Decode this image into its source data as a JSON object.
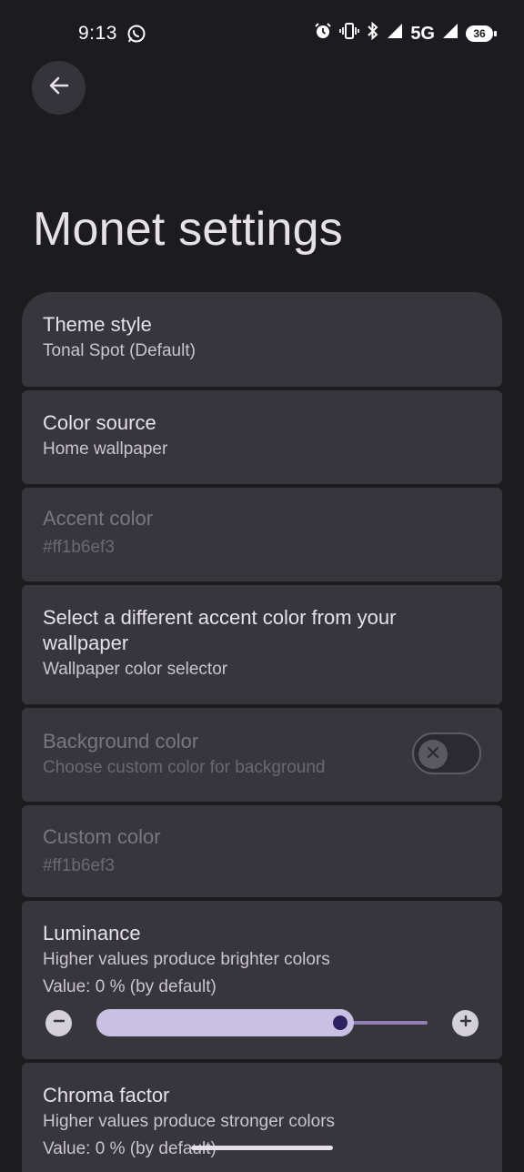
{
  "status_bar": {
    "time": "9:13",
    "network": "5G",
    "battery": "36",
    "icons": [
      "whatsapp-icon",
      "alarm-icon",
      "vibrate-icon",
      "bluetooth-icon",
      "signal-icon",
      "signal-5g-icon",
      "battery-icon"
    ]
  },
  "header": {
    "back_icon": "arrow-back-icon",
    "title": "Monet settings"
  },
  "settings": {
    "theme_style": {
      "title": "Theme style",
      "value": "Tonal Spot (Default)"
    },
    "color_source": {
      "title": "Color source",
      "value": "Home wallpaper"
    },
    "accent_color": {
      "title": "Accent color",
      "value": "#ff1b6ef3",
      "enabled": false
    },
    "wallpaper_accent": {
      "title": "Select a different accent color from your wallpaper",
      "value": "Wallpaper color selector"
    },
    "background_color": {
      "title": "Background color",
      "value": "Choose custom color for background",
      "enabled": false,
      "toggle_on": false
    },
    "custom_color": {
      "title": "Custom color",
      "value": "#ff1b6ef3",
      "enabled": false
    },
    "luminance": {
      "title": "Luminance",
      "description": "Higher values produce brighter colors",
      "value_text": "Value: 0 % (by default)",
      "slider_fraction": 0.75
    },
    "chroma_factor": {
      "title": "Chroma factor",
      "description": "Higher values produce stronger colors",
      "value_text": "Value: 0 % (by default)"
    }
  },
  "colors": {
    "background": "#1c1b20",
    "card": "#38363d",
    "accent": "#c9c0e4"
  }
}
